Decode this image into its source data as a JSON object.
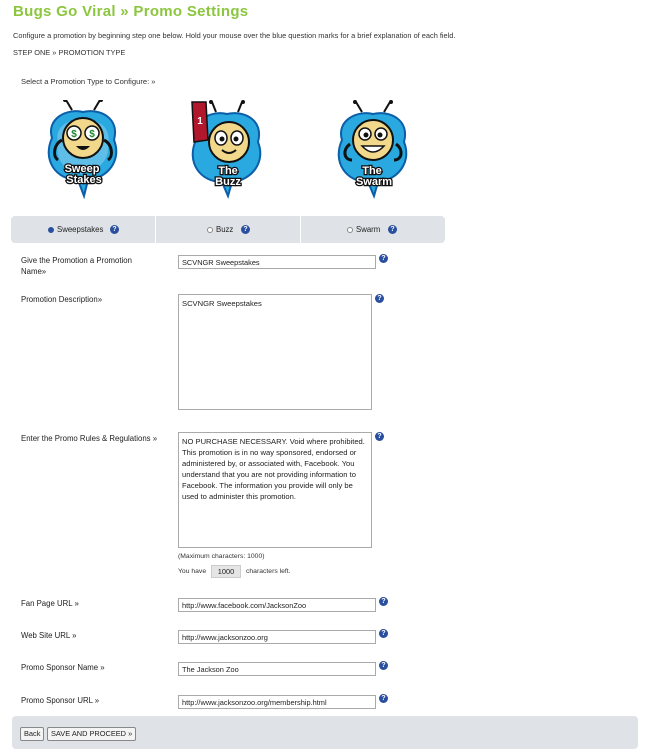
{
  "header": {
    "title": "Bugs Go Viral » Promo Settings",
    "instructions": "Configure a promotion by beginning step one below. Hold your mouse over the blue question marks for a brief explanation of each field.",
    "step_one": "STEP ONE » PROMOTION TYPE"
  },
  "promotion_types": {
    "select_label": "Select a Promotion Type to Configure: »",
    "logos": [
      {
        "word1": "Sweep",
        "word2": "Stakes",
        "icon": "sweepstakes-bug-icon"
      },
      {
        "word1": "The",
        "word2": "Buzz",
        "icon": "buzz-bug-icon"
      },
      {
        "word1": "The",
        "word2": "Swarm",
        "icon": "swarm-bug-icon"
      }
    ],
    "options": [
      {
        "label": "Sweepstakes",
        "selected": true
      },
      {
        "label": "Buzz",
        "selected": false
      },
      {
        "label": "Swarm",
        "selected": false
      }
    ],
    "help_glyph": "?"
  },
  "form": {
    "promo_name": {
      "label": "Give the Promotion a Promotion Name»",
      "value": "SCVNGR Sweepstakes"
    },
    "description": {
      "label": "Promotion Description»",
      "value": "SCVNGR Sweepstakes"
    },
    "rules": {
      "label": "Enter the Promo Rules & Regulations »",
      "value": "NO PURCHASE NECESSARY. Void where prohibited. This promotion is in no way sponsored, endorsed or administered by, or associated with, Facebook. You understand that you are not providing information to Facebook. The information you provide will only be used to administer this promotion.",
      "max_note": "(Maximum characters: 1000)",
      "you_have": "You have",
      "remaining": "1000",
      "chars_left": "characters left."
    },
    "fan_page_url": {
      "label": "Fan Page URL »",
      "value": "http://www.facebook.com/JacksonZoo"
    },
    "web_site_url": {
      "label": "Web Site URL »",
      "value": "http://www.jacksonzoo.org"
    },
    "sponsor_name": {
      "label": "Promo Sponsor Name »",
      "value": "The Jackson Zoo"
    },
    "sponsor_url": {
      "label": "Promo Sponsor URL »",
      "value": "http://www.jacksonzoo.org/membership.html"
    }
  },
  "footer": {
    "back_label": "Back",
    "proceed_label": "SAVE AND PROCEED »"
  },
  "colors": {
    "title_green": "#8cc63f",
    "help_blue": "#2a4f9e",
    "tab_gray": "#dfe3e8"
  }
}
